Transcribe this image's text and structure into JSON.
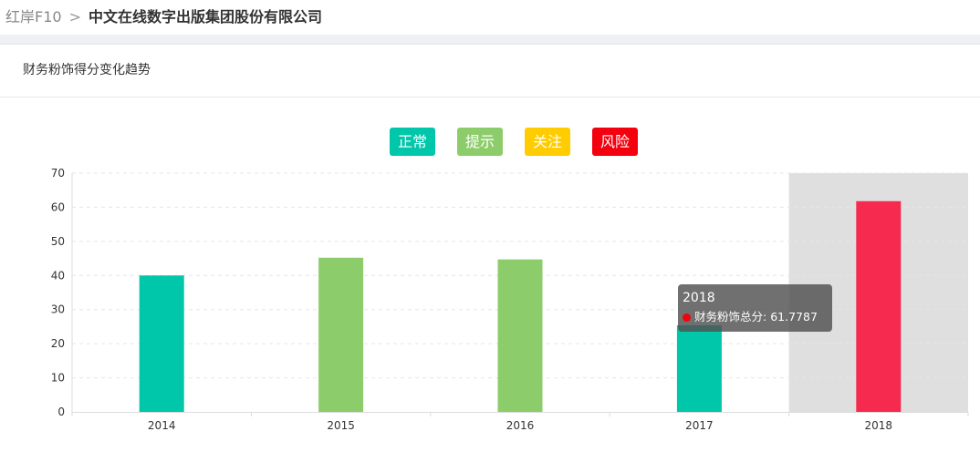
{
  "breadcrumb": {
    "home": "红岸F10",
    "separator": ">",
    "company": "中文在线数字出版集团股份有限公司"
  },
  "panel": {
    "title": "财务粉饰得分变化趋势"
  },
  "legend": [
    {
      "label": "正常",
      "color": "#00c6aa"
    },
    {
      "label": "提示",
      "color": "#8dcc6b"
    },
    {
      "label": "关注",
      "color": "#ffcc00"
    },
    {
      "label": "风险",
      "color": "#f5000e"
    }
  ],
  "chart_data": {
    "type": "bar",
    "categories": [
      "2014",
      "2015",
      "2016",
      "2017",
      "2018"
    ],
    "series": [
      {
        "name": "财务粉饰总分",
        "values": [
          40.0,
          45.2,
          44.7,
          25.4,
          61.7787
        ]
      }
    ],
    "bar_colors": [
      "#00c6aa",
      "#8dcc6b",
      "#8dcc6b",
      "#00c6aa",
      "#f6294f"
    ],
    "ylim": [
      0,
      70
    ],
    "yticks": [
      "0",
      "10",
      "20",
      "30",
      "40",
      "50",
      "60",
      "70"
    ],
    "xlabel": "",
    "ylabel": "",
    "grid": true,
    "highlight_category": "2018",
    "highlight_color": "#dfdfdf"
  },
  "tooltip": {
    "title": "2018",
    "series_label": "财务粉饰总分",
    "value_text": "61.7787",
    "dot_color": "#f5000e"
  }
}
